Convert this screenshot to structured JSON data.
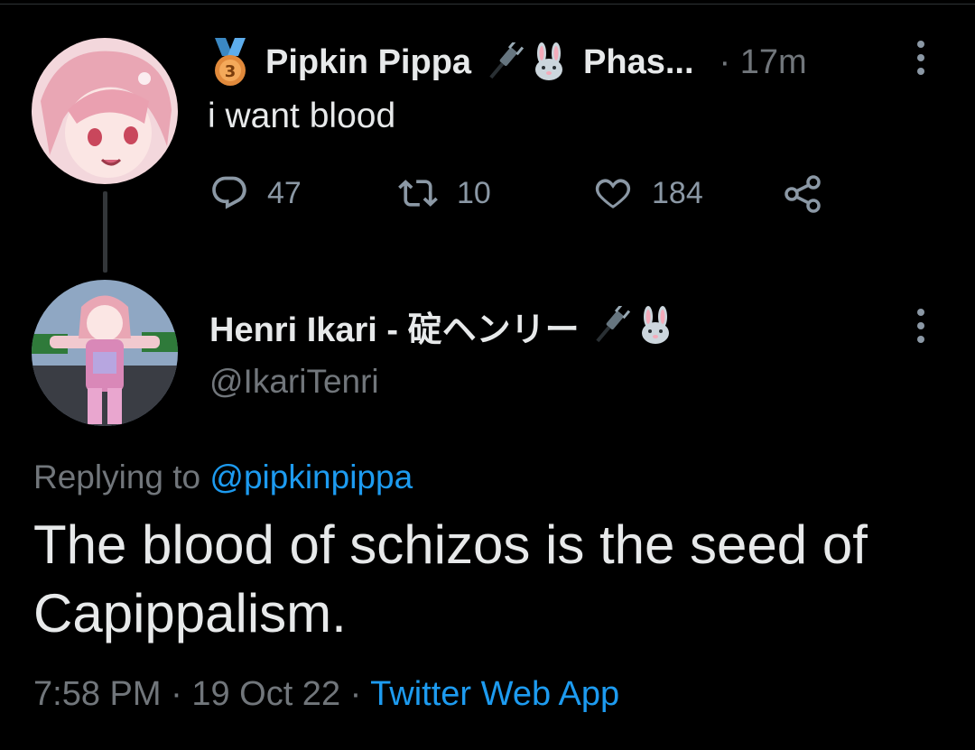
{
  "tweet1": {
    "display_name": "Pipkin Pippa",
    "handle_truncated": "Phas...",
    "separator": "·",
    "time": "17m",
    "text": "i want blood",
    "reply_count": "47",
    "retweet_count": "10",
    "like_count": "184",
    "badges": [
      "medal-3-icon",
      "plug-icon",
      "bunny-icon"
    ]
  },
  "tweet2": {
    "display_name": "Henri Ikari - 碇ヘンリー",
    "handle": "@IkariTenri",
    "replying_prefix": "Replying to",
    "replying_handle": "@pipkinpippa",
    "text": "The blood of schizos is the seed of Capippalism.",
    "time": "7:58 PM",
    "sep1": "·",
    "date": "19 Oct 22",
    "sep2": "·",
    "source": "Twitter Web App",
    "badges": [
      "plug-icon",
      "bunny-icon"
    ]
  },
  "colors": {
    "background": "#000000",
    "text": "#e7e9ea",
    "muted": "#71767b",
    "accent": "#1d9bf0"
  }
}
